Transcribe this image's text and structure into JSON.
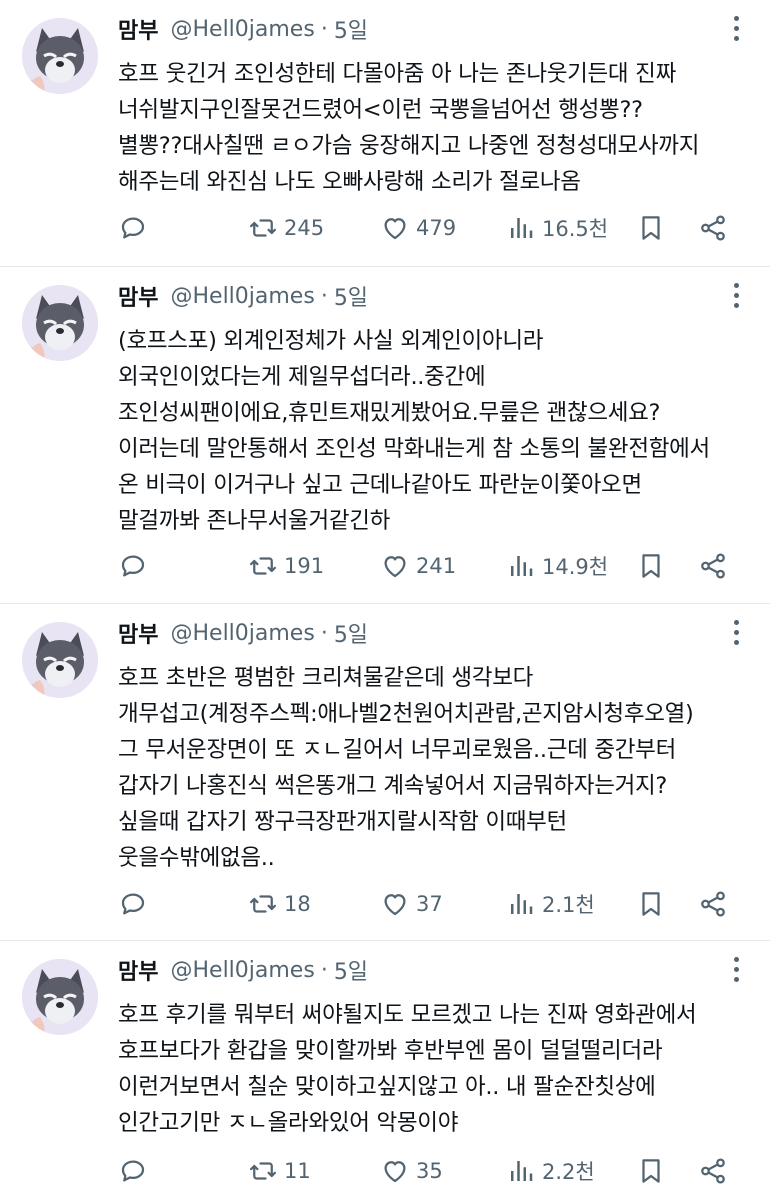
{
  "tweets": [
    {
      "name": "맘부",
      "handle": "@Hell0james",
      "time": "5일",
      "lines": [
        "호프 웃긴거 조인성한테 다몰아줌 아 나는 존나웃기든대 진짜",
        "너쉬발지구인잘못건드렸어<이런 국뽕을넘어선 행성뽕??",
        "별뽕??대사칠땐 ㄹㅇ가슴 웅장해지고 나중엔 정청성대모사까지",
        "해주는데 와진심  나도 오빠사랑해 소리가 절로나옴"
      ],
      "retweets": "245",
      "likes": "479",
      "views": "16.5천"
    },
    {
      "name": "맘부",
      "handle": "@Hell0james",
      "time": "5일",
      "lines": [
        "(호프스포) 외계인정체가 사실 외계인이아니라",
        "외국인이었다는게 제일무섭더라..중간에",
        "조인성씨팬이에요,휴민트재밌게봤어요.무릎은 괜찮으세요?",
        "이러는데 말안통해서 조인성 막화내는게 참 소통의 불완전함에서",
        "온 비극이 이거구나 싶고 근데나같아도 파란눈이쫓아오면",
        "말걸까봐 존나무서울거같긴하"
      ],
      "retweets": "191",
      "likes": "241",
      "views": "14.9천"
    },
    {
      "name": "맘부",
      "handle": "@Hell0james",
      "time": "5일",
      "lines": [
        "호프 초반은 평범한 크리쳐물같은데 생각보다",
        "개무섭고(계정주스펙:애나벨2천원어치관람,곤지암시청후오열)",
        "그 무서운장면이 또 ㅈㄴ길어서 너무괴로웠음..근데 중간부터",
        "갑자기 나홍진식 썩은똥개그 계속넣어서 지금뭐하자는거지?",
        "싶을때 갑자기 짱구극장판개지랄시작함 이때부턴",
        "웃을수밖에없음.."
      ],
      "retweets": "18",
      "likes": "37",
      "views": "2.1천"
    },
    {
      "name": "맘부",
      "handle": "@Hell0james",
      "time": "5일",
      "lines": [
        "호프 후기를 뭐부터 써야될지도 모르겠고 나는 진짜 영화관에서",
        "호프보다가 환갑을 맞이할까봐 후반부엔 몸이 덜덜떨리더라",
        "이런거보면서 칠순 맞이하고싶지않고 아.. 내 팔순잔칫상에",
        "인간고기만 ㅈㄴ올라와있어 악몽이야"
      ],
      "retweets": "11",
      "likes": "35",
      "views": "2.2천"
    }
  ],
  "icons": {
    "reply": "reply-icon",
    "retweet": "retweet-icon",
    "like": "like-icon",
    "views": "views-icon",
    "bookmark": "bookmark-icon",
    "share": "share-icon",
    "more": "more-icon"
  },
  "colors": {
    "text": "#0f1419",
    "secondary": "#536471",
    "divider": "#e6e9ec"
  }
}
